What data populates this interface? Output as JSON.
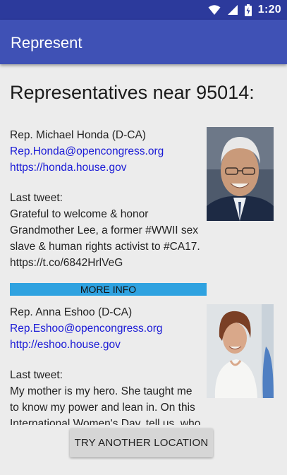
{
  "status_bar": {
    "time": "1:20"
  },
  "app_bar": {
    "title": "Represent"
  },
  "heading": "Representatives near 95014:",
  "representatives": [
    {
      "name": "Rep. Michael Honda (D-CA)",
      "email": "Rep.Honda@opencongress.org",
      "website": "https://honda.house.gov",
      "last_tweet_label": "Last tweet:",
      "tweet_lines": [
        "Grateful to welcome & honor",
        "Grandmother Lee, a former #WWII sex",
        "slave & human rights activist to #CA17.",
        "https://t.co/6842HrlVeG"
      ],
      "more_info_label": "MORE INFO"
    },
    {
      "name": "Rep. Anna Eshoo (D-CA)",
      "email": "Rep.Eshoo@opencongress.org",
      "website": "http://eshoo.house.gov",
      "last_tweet_label": "Last tweet:",
      "tweet_lines": [
        "My mother is my hero. She taught me",
        "to know my power and lean in. On this",
        "International Women's Day, tell us, who"
      ]
    }
  ],
  "bottom_button": {
    "label": "TRY ANOTHER LOCATION"
  }
}
